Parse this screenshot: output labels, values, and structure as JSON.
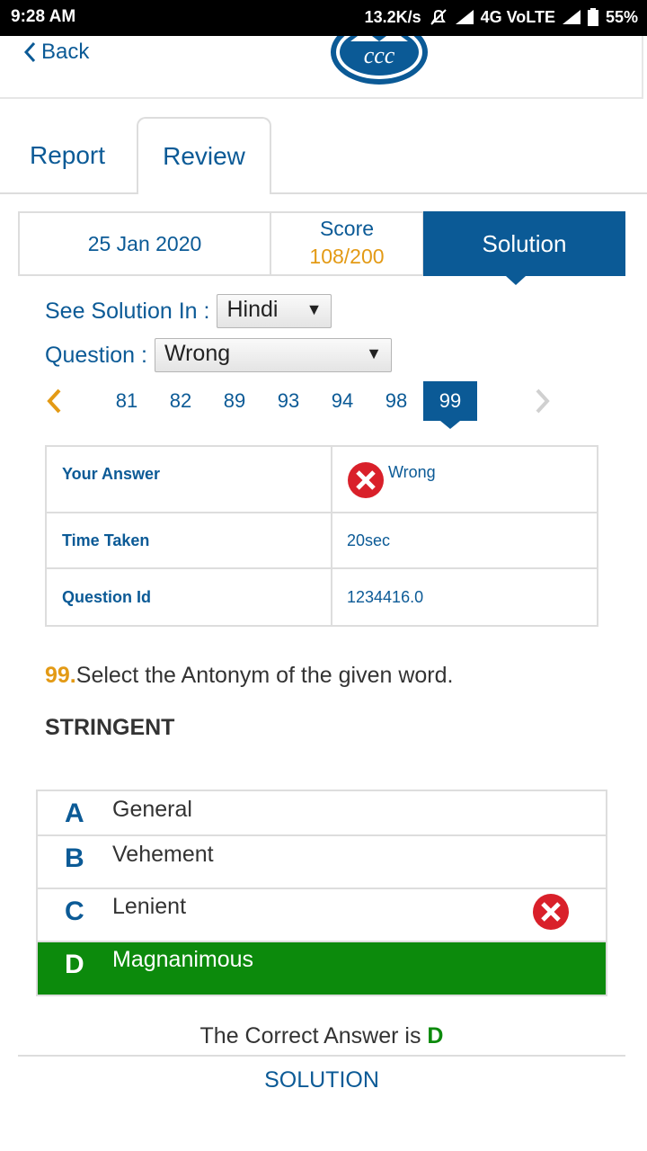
{
  "status_bar": {
    "time": "9:28 AM",
    "net_speed": "13.2K/s",
    "network": "4G VoLTE",
    "battery": "55%"
  },
  "header": {
    "back_label": "Back",
    "logo_text": "ccc"
  },
  "tabs": [
    {
      "label": "Report",
      "active": false
    },
    {
      "label": "Review",
      "active": true
    }
  ],
  "summary": {
    "date": "25 Jan 2020",
    "score_label": "Score",
    "score_value": "108/200",
    "solution_label": "Solution"
  },
  "filters": {
    "solution_lang_label": "See Solution In :",
    "solution_lang_value": "Hindi",
    "question_label": "Question :",
    "question_value": "Wrong"
  },
  "pager": {
    "pages": [
      "81",
      "82",
      "89",
      "93",
      "94",
      "98",
      "99"
    ],
    "active": "99"
  },
  "info": {
    "answer_label": "Your Answer",
    "answer_value": "Wrong",
    "time_label": "Time Taken",
    "time_value": "20sec",
    "qid_label": "Question Id",
    "qid_value": "1234416.0"
  },
  "question": {
    "number": "99.",
    "text": "Select the Antonym of the given word.",
    "word": "STRINGENT"
  },
  "options": [
    {
      "letter": "A",
      "text": "General"
    },
    {
      "letter": "B",
      "text": "Vehement"
    },
    {
      "letter": "C",
      "text": "Lenient"
    },
    {
      "letter": "D",
      "text": "Magnanimous"
    }
  ],
  "result": {
    "correct_prefix": "The Correct Answer is",
    "correct_letter": "D",
    "solution_link": "SOLUTION"
  },
  "colors": {
    "primary": "#0b5a96",
    "accent": "#e39a15",
    "correct": "#0c8a0c",
    "wrong": "#d9202a"
  }
}
